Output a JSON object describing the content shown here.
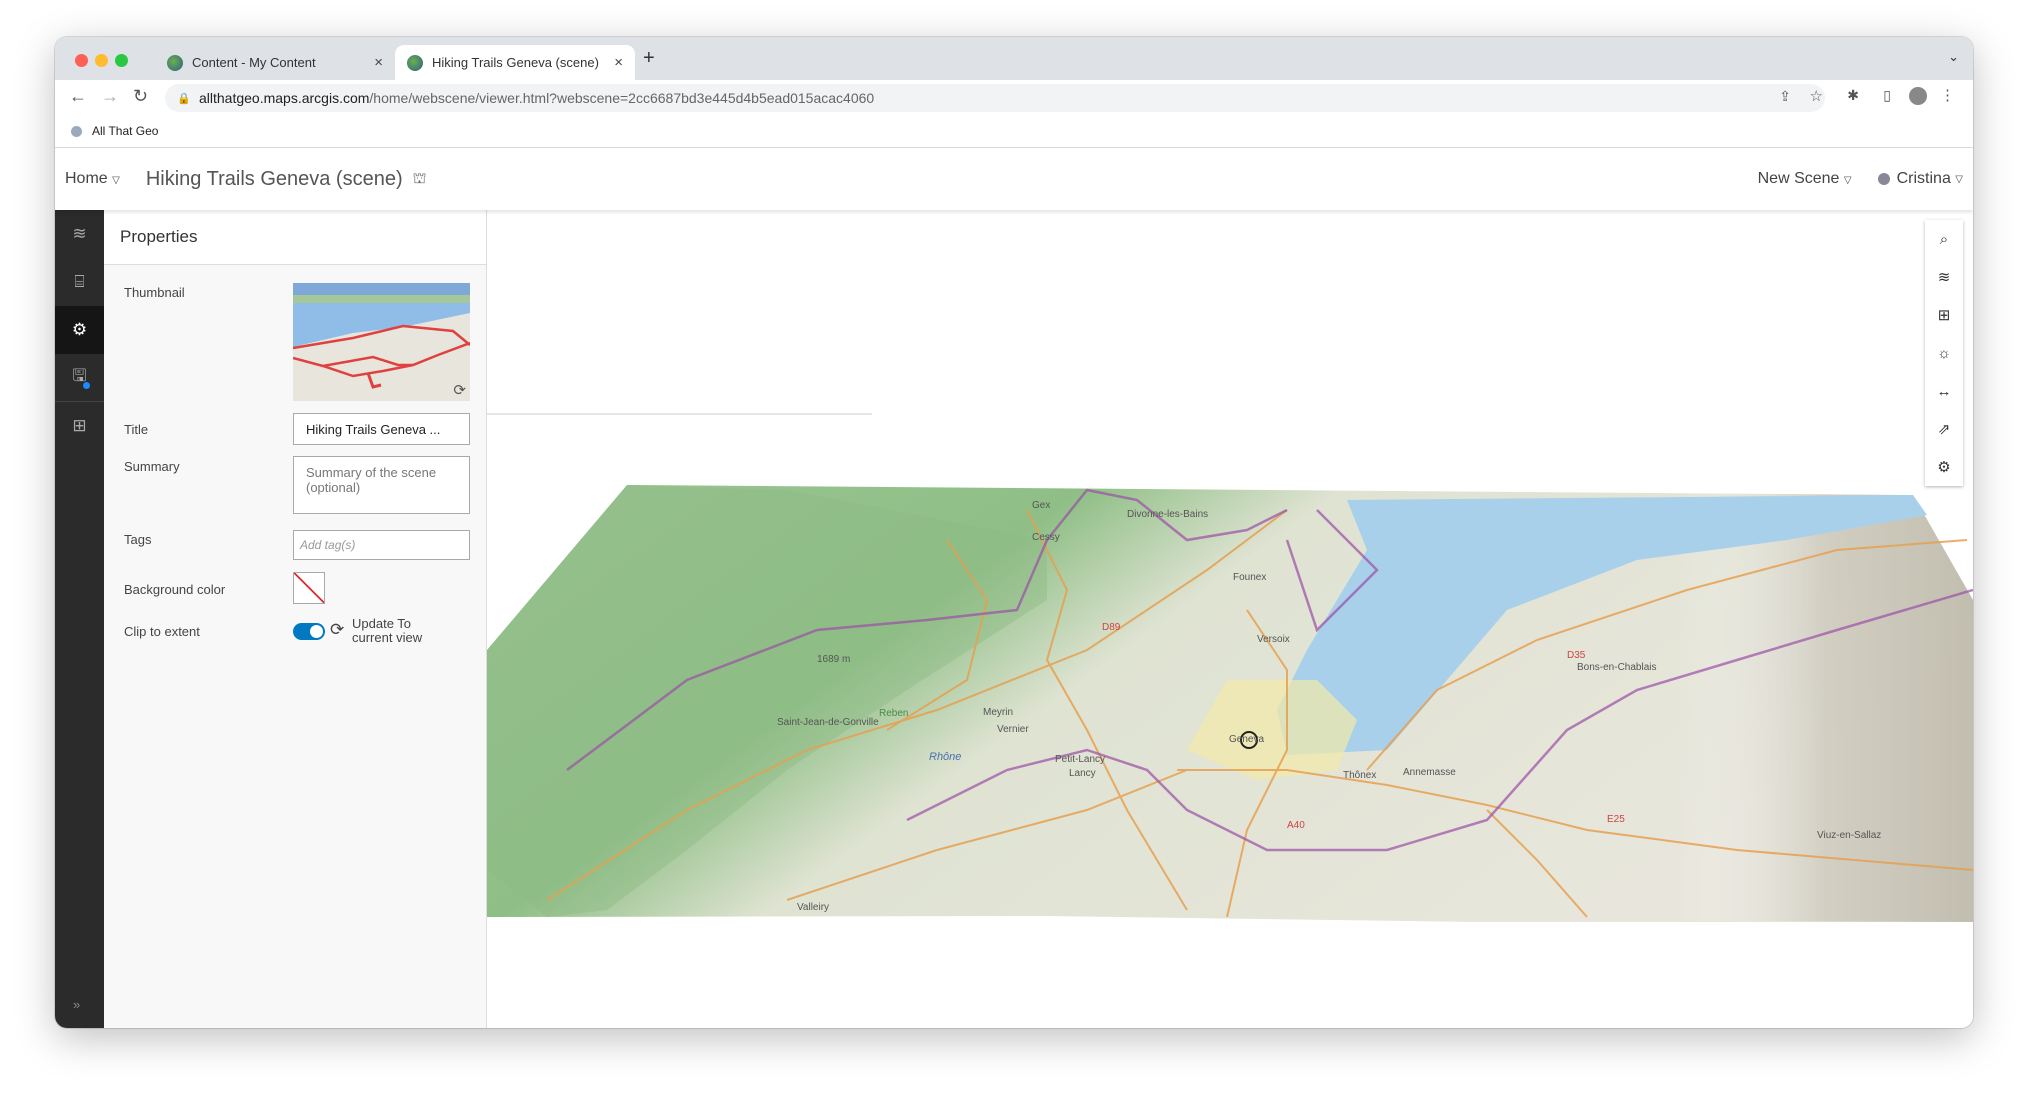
{
  "browser": {
    "tabs": [
      {
        "label": "Content - My Content",
        "active": false
      },
      {
        "label": "Hiking Trails Geneva (scene)",
        "active": true
      }
    ],
    "url_host": "allthatgeo.maps.arcgis.com",
    "url_path": "/home/webscene/viewer.html?webscene=2cc6687bd3e445d4b5ead015acac4060",
    "bookmarks": [
      {
        "label": "All That Geo"
      }
    ]
  },
  "header": {
    "home": "Home",
    "title": "Hiking Trails Geneva (scene)",
    "new_scene": "New Scene",
    "user": "Cristina"
  },
  "sidebar": {
    "items": [
      {
        "icon": "layers-icon"
      },
      {
        "icon": "slides-icon"
      },
      {
        "icon": "gear-icon",
        "active": true
      },
      {
        "icon": "save-icon"
      },
      {
        "icon": "grid-icon"
      }
    ],
    "expand": "»"
  },
  "properties": {
    "heading": "Properties",
    "thumbnail_label": "Thumbnail",
    "title_label": "Title",
    "title_value": "Hiking Trails Geneva ...",
    "summary_label": "Summary",
    "summary_placeholder": "Summary of the scene (optional)",
    "tags_label": "Tags",
    "tags_placeholder": "Add tag(s)",
    "bg_label": "Background color",
    "clip_label": "Clip to extent",
    "clip_on": true,
    "update_line1": "Update To",
    "update_line2": "current view"
  },
  "map_tools": [
    {
      "icon": "search-icon"
    },
    {
      "icon": "layers-icon"
    },
    {
      "icon": "basemap-gallery-icon"
    },
    {
      "icon": "daylight-icon"
    },
    {
      "icon": "measure-icon"
    },
    {
      "icon": "share-icon"
    },
    {
      "icon": "settings-icon"
    }
  ],
  "map_labels": [
    "Gex",
    "Cessy",
    "Divonne-les-Bains",
    "Founex",
    "Versoix",
    "Meyrin",
    "Vernier",
    "Reben",
    "Rhône",
    "Geneva",
    "Petit-Lancy",
    "Lancy",
    "Thônex",
    "Annemasse",
    "Saint-Jean-de-Gonville",
    "1689 m",
    "D89",
    "D35",
    "E25",
    "A40",
    "Bons-en-Chablais",
    "Viuz-en-Sallaz",
    "Valleiry"
  ],
  "colors": {
    "accent": "#0079c1",
    "lake": "#a9d0ea",
    "forest": "#8fc08a",
    "land": "#e8e6dc",
    "trail": "#9b4fa6",
    "road": "#e6a050"
  }
}
